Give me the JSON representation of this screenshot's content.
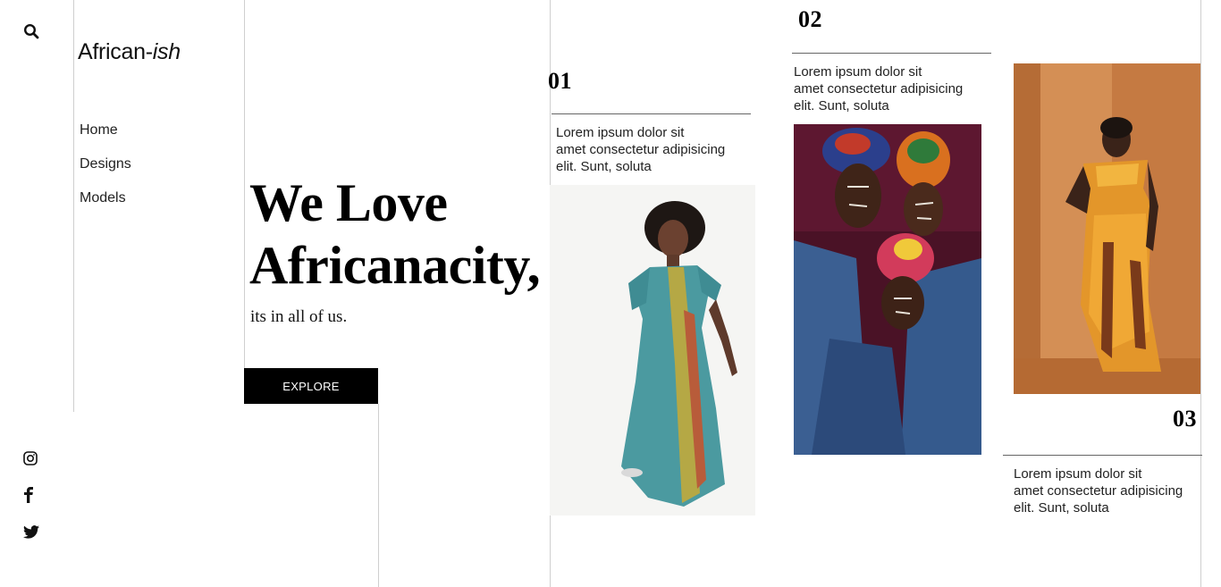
{
  "brand": {
    "name": "African-",
    "suffix": "ish"
  },
  "nav": {
    "items": [
      {
        "label": "Home"
      },
      {
        "label": "Designs"
      },
      {
        "label": "Models"
      }
    ]
  },
  "hero": {
    "title_line1": "We Love",
    "title_line2": "Africanacity,",
    "subtitle": "its in all of us.",
    "cta": "EXPLORE"
  },
  "cards": [
    {
      "number": "01",
      "line1": "Lorem ipsum dolor sit",
      "line2": "amet consectetur adipisicing",
      "line3": "elit. Sunt, soluta"
    },
    {
      "number": "02",
      "line1": "Lorem ipsum dolor sit",
      "line2": "amet consectetur adipisicing",
      "line3": "elit. Sunt, soluta"
    },
    {
      "number": "03",
      "line1": "Lorem ipsum dolor sit",
      "line2": "amet consectetur adipisicing",
      "line3": "elit. Sunt, soluta"
    }
  ],
  "icons": {
    "search": "search-icon",
    "instagram": "instagram-icon",
    "facebook": "facebook-icon",
    "twitter": "twitter-icon"
  },
  "colors": {
    "text": "#111111",
    "button_bg": "#000000",
    "button_text": "#ffffff",
    "divider": "#cfcfcf"
  }
}
